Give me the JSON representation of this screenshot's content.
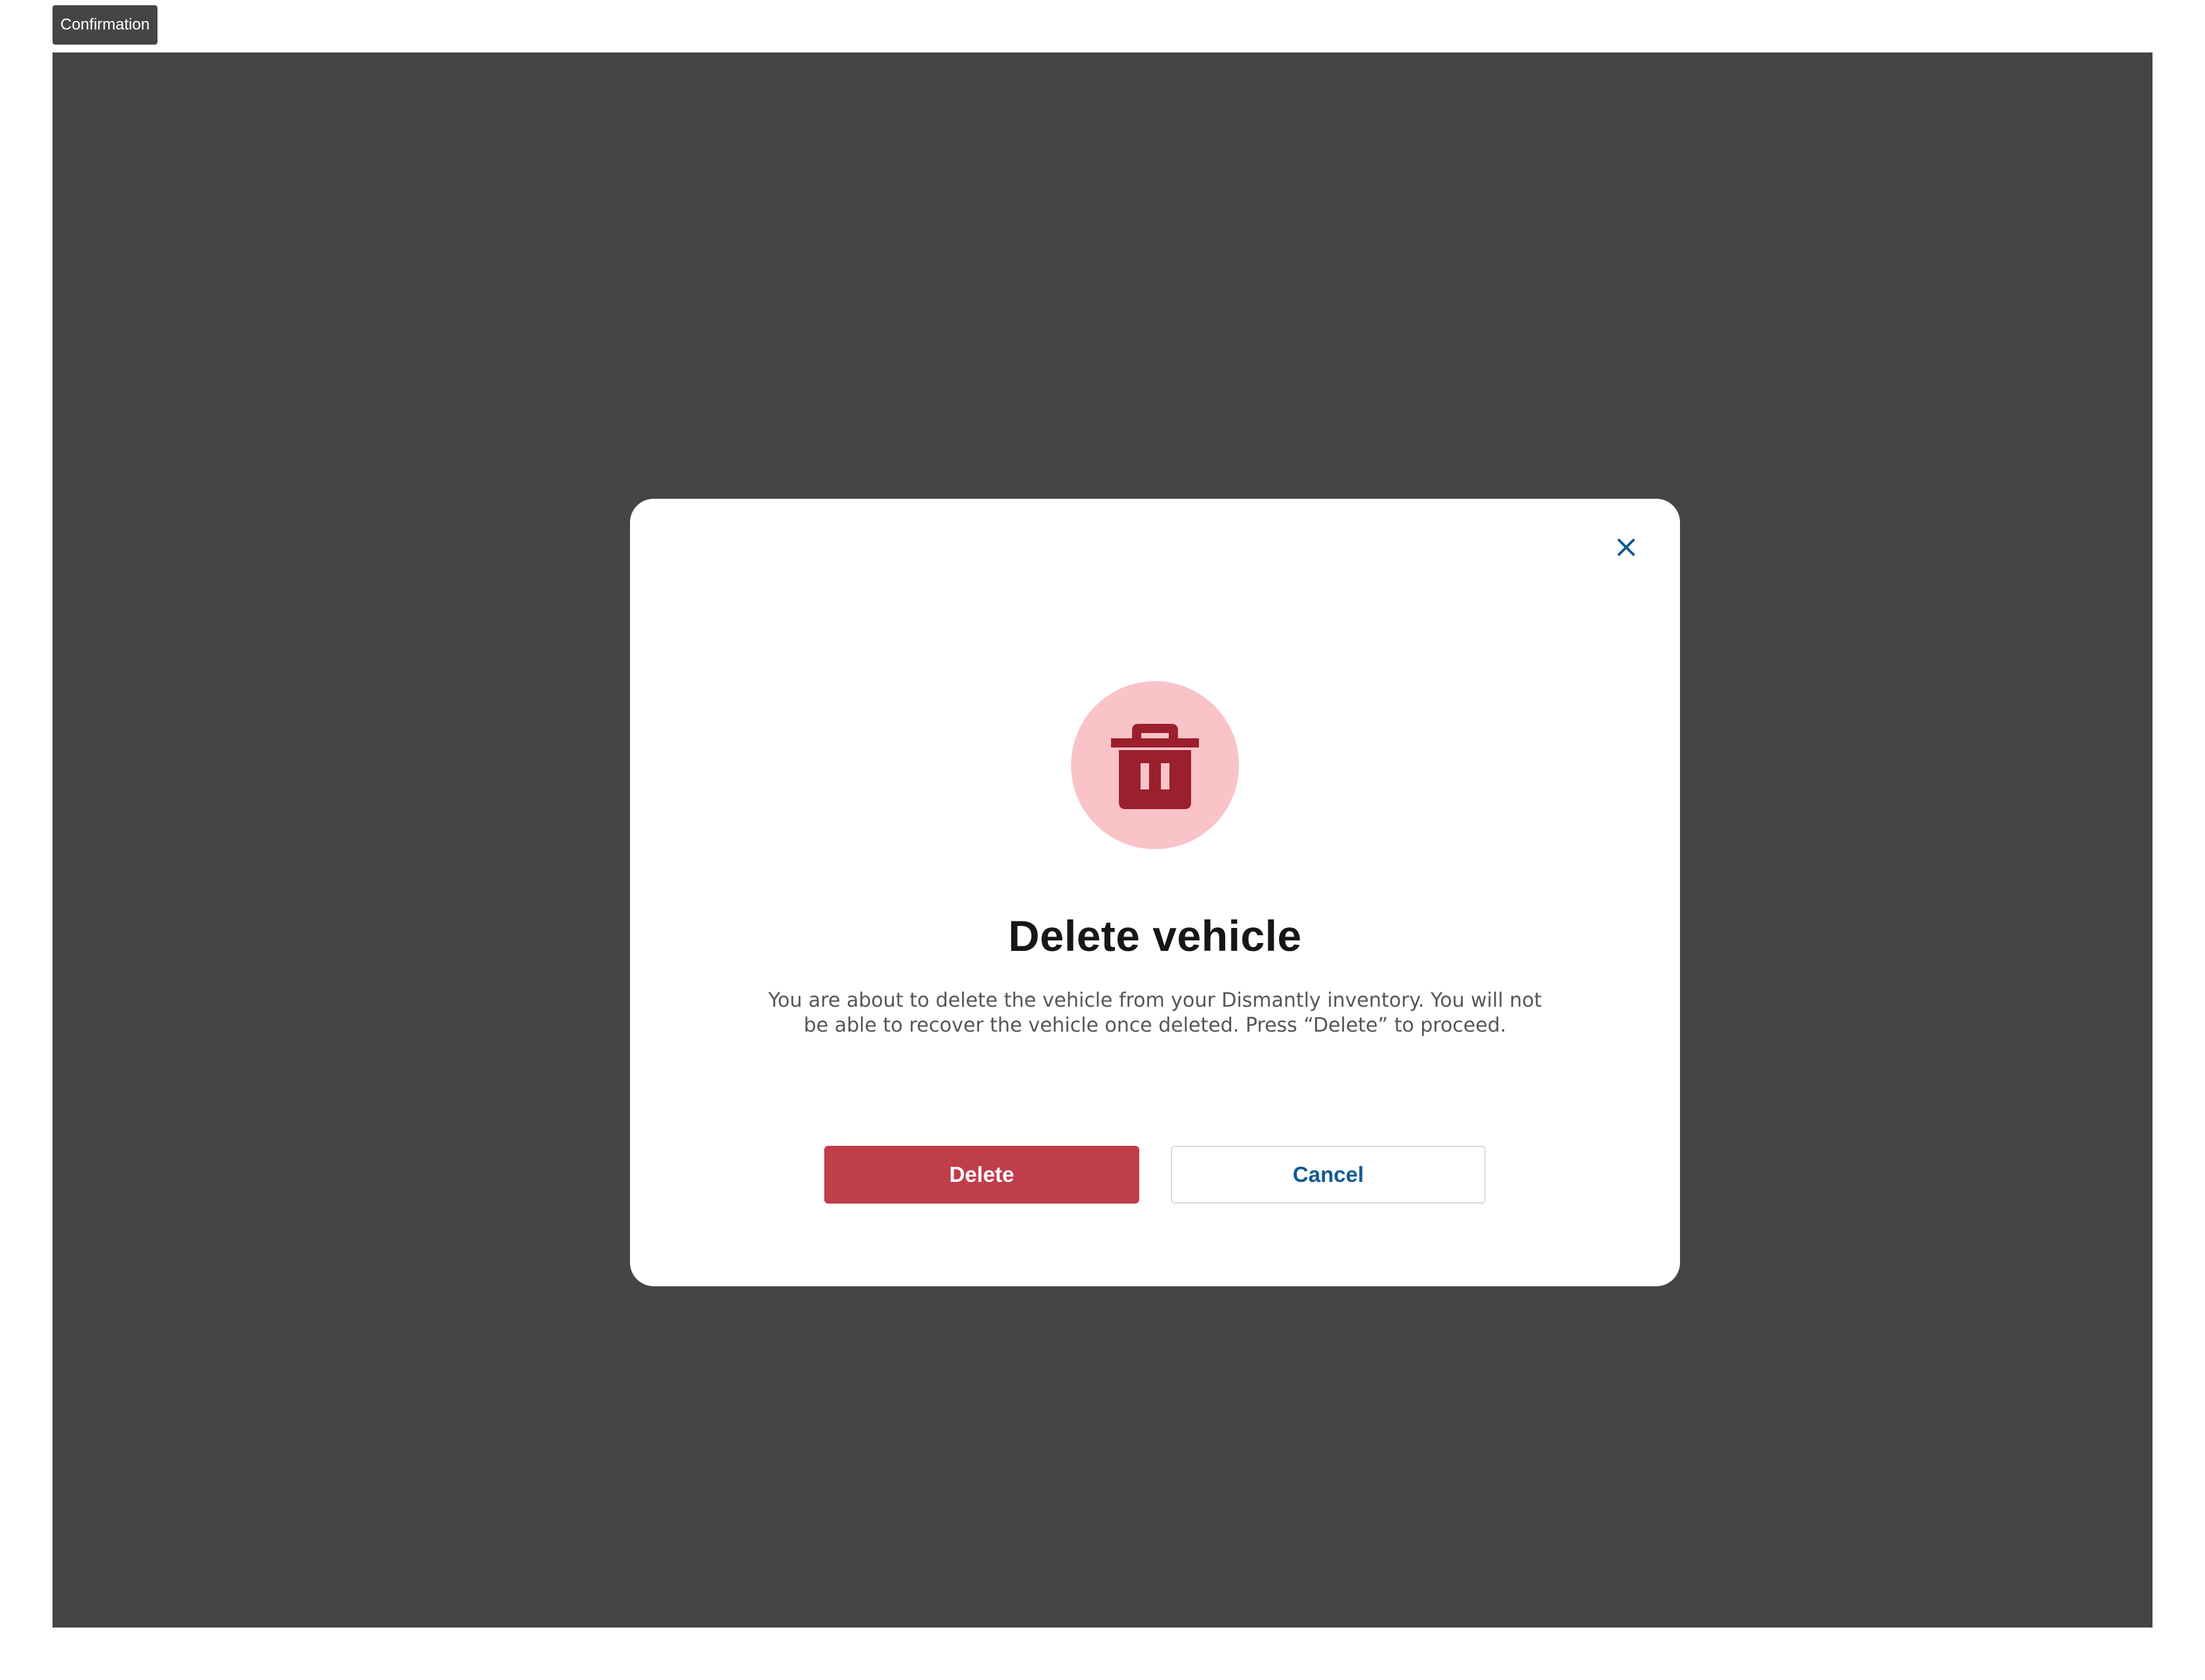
{
  "frame": {
    "label": "Confirmation"
  },
  "modal": {
    "title": "Delete vehicle",
    "description": "You are about to delete the vehicle from your Dismantly inventory. You will not be able to recover the vehicle once deleted. Press “Delete” to proceed.",
    "icon": "trash-icon",
    "close_icon": "close-icon",
    "delete_label": "Delete",
    "cancel_label": "Cancel"
  },
  "colors": {
    "overlay": "#454545",
    "danger": "#c03d4a",
    "danger_light": "#f9c3c8",
    "icon_dark": "#9b1f2c",
    "link_blue": "#0f5a94"
  }
}
